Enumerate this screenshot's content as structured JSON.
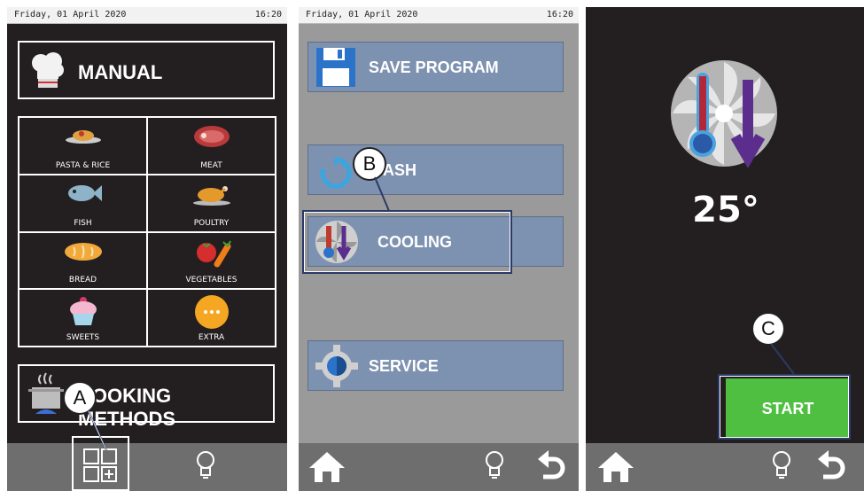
{
  "status": {
    "date": "Friday, 01 April 2020",
    "time": "16:20"
  },
  "screen1": {
    "manual_label": "MANUAL",
    "categories": [
      "PASTA & RICE",
      "MEAT",
      "FISH",
      "POULTRY",
      "BREAD",
      "VEGETABLES",
      "SWEETS",
      "EXTRA"
    ],
    "cooking_methods_label": "COOKING METHODS"
  },
  "screen2": {
    "items": [
      "SAVE PROGRAM",
      "WASH",
      "COOLING",
      "SERVICE"
    ]
  },
  "screen3": {
    "temperature": "25°",
    "start_label": "START"
  },
  "callouts": {
    "a": "A",
    "b": "B",
    "c": "C"
  },
  "colors": {
    "dark_bg": "#231f20",
    "menu_btn": "#7d91b0",
    "start_green": "#4fbf41",
    "bar_gray": "#6e6e6e"
  }
}
